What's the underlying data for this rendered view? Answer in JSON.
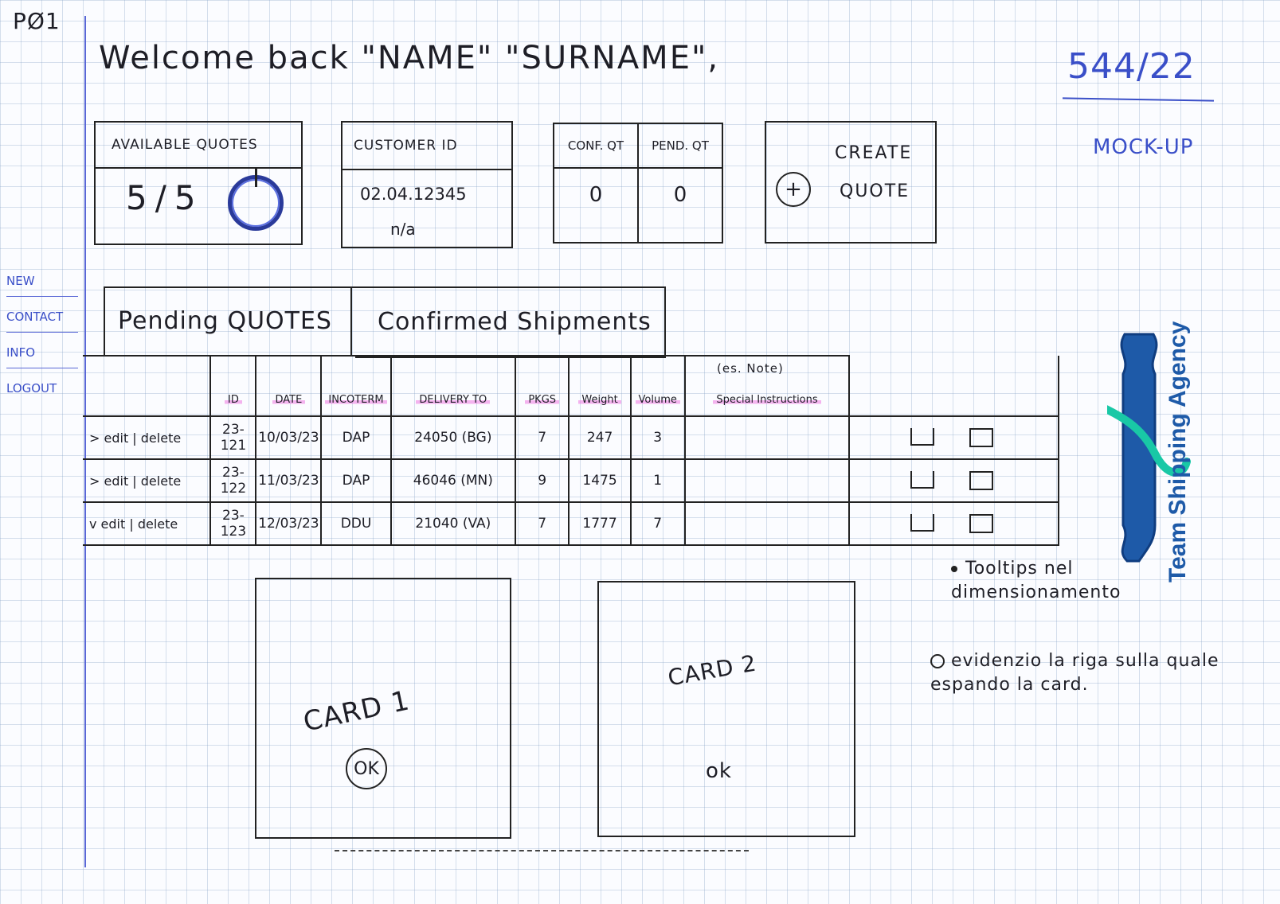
{
  "page_id": "PØ1",
  "welcome": "Welcome back \"NAME\" \"SURNAME\",",
  "doc_number": "544/22",
  "mockup_label": "MOCK-UP",
  "side_nav": [
    "NEW",
    "CONTACT",
    "INFO",
    "LOGOUT"
  ],
  "available_quotes": {
    "title": "AVAILABLE QUOTES",
    "value": "5/5"
  },
  "customer": {
    "title": "CUSTOMER ID",
    "id": "02.04.12345",
    "sub": "n/a"
  },
  "quotes_counts": {
    "conf_label": "CONF. QT",
    "conf_value": "0",
    "pend_label": "PEND. QT",
    "pend_value": "0"
  },
  "create": {
    "line1": "CREATE",
    "line2": "QUOTE",
    "icon": "plus-circle"
  },
  "tabs": [
    "Pending QUOTES",
    "Confirmed Shipments"
  ],
  "table": {
    "note_above": "(es. Note)",
    "headers": [
      "",
      "ID",
      "DATE",
      "INCOTERM",
      "DELIVERY TO",
      "PKGS",
      "Weight",
      "Volume",
      "Special Instructions",
      ""
    ],
    "rows": [
      {
        "actions": "> edit | delete",
        "id": "23-121",
        "date": "10/03/23",
        "incoterm": "DAP",
        "delivery": "24050 (BG)",
        "pkgs": "7",
        "weight": "247",
        "volume": "3",
        "special": ""
      },
      {
        "actions": "> edit | delete",
        "id": "23-122",
        "date": "11/03/23",
        "incoterm": "DAP",
        "delivery": "46046 (MN)",
        "pkgs": "9",
        "weight": "1475",
        "volume": "1",
        "special": ""
      },
      {
        "actions": "v edit | delete",
        "id": "23-123",
        "date": "12/03/23",
        "incoterm": "DDU",
        "delivery": "21040 (VA)",
        "pkgs": "7",
        "weight": "1777",
        "volume": "7",
        "special": ""
      }
    ]
  },
  "logo": {
    "text": "Team Shipping Agency",
    "colors": {
      "blue": "#1e5aa8",
      "teal": "#19c8a6"
    }
  },
  "cards": [
    {
      "title": "CARD 1",
      "ok": "OK"
    },
    {
      "title": "CARD 2",
      "ok": "ok"
    }
  ],
  "notes": [
    "Tooltips nel dimensionamento",
    "evidenzio la riga sulla quale espando la card."
  ]
}
